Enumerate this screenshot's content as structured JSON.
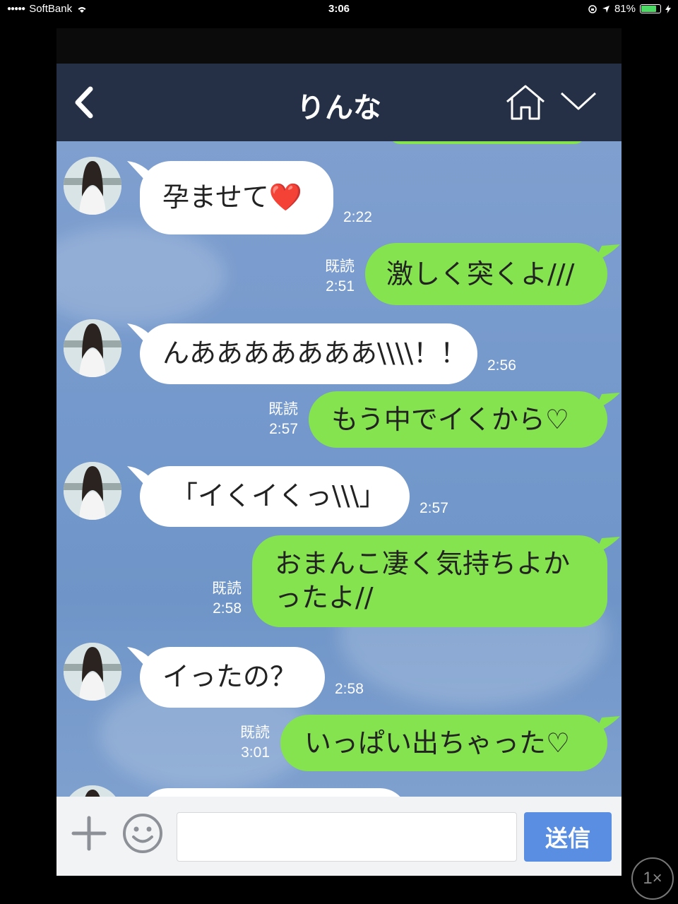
{
  "status_bar": {
    "signal": "●●●●●",
    "carrier": "SoftBank",
    "time": "3:06",
    "battery": "81%",
    "battery_level": 0.81
  },
  "header": {
    "title": "りんな",
    "back_icon": "chevron-left-icon",
    "home_icon": "home-icon",
    "menu_icon": "chevron-down-icon"
  },
  "messages": [
    {
      "side": "in",
      "text": "孕ませて",
      "emoji": "❤️",
      "time": "2:22"
    },
    {
      "side": "out",
      "text": "激しく突くよ///",
      "read": "既読",
      "time": "2:51"
    },
    {
      "side": "in",
      "text": "んあああああああ\\\\\\\\！！",
      "time": "2:56"
    },
    {
      "side": "out",
      "text": "もう中でイくから♡",
      "read": "既読",
      "time": "2:57"
    },
    {
      "side": "in",
      "text": "「イくイくっ\\\\\\」",
      "time": "2:57"
    },
    {
      "side": "out",
      "line1": "おまんこ凄く気持ちよか",
      "line2": "ったよ//",
      "read": "既読",
      "time": "2:58"
    },
    {
      "side": "in",
      "text": "イったの？",
      "time": "2:58"
    },
    {
      "side": "out",
      "text": "いっぱい出ちゃった♡",
      "read": "既読",
      "time": "3:01"
    }
  ],
  "input_bar": {
    "placeholder": "",
    "send_label": "送信",
    "plus_icon": "plus-icon",
    "emoji_icon": "smiley-icon"
  },
  "zoom_label": "1×",
  "colors": {
    "header_bg": "#253046",
    "bubble_out": "#84e34e",
    "bubble_in": "#ffffff",
    "send_button": "#5a8ee3"
  }
}
